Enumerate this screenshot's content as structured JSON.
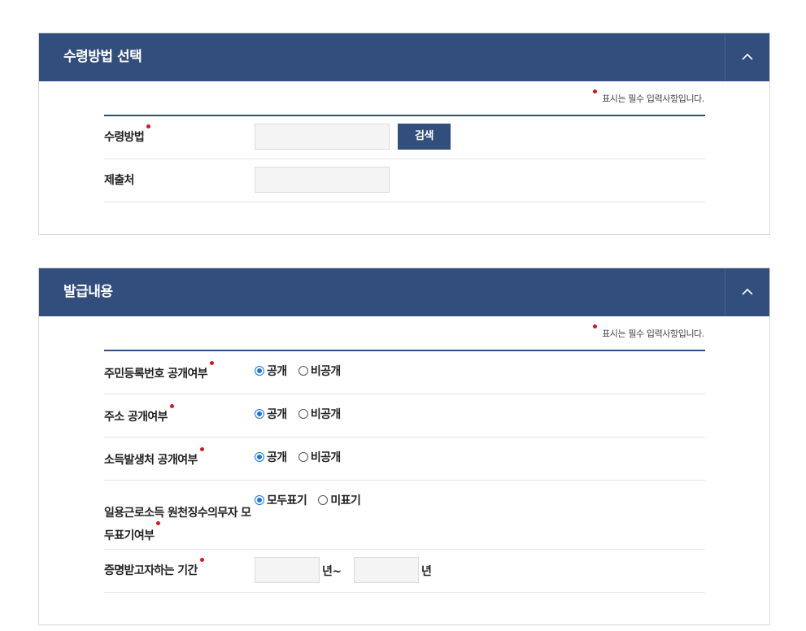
{
  "section1": {
    "title": "수령방법 선택",
    "required_note": "표시는 필수 입력사항입니다.",
    "rows": {
      "receive_method": {
        "label": "수령방법",
        "value": "",
        "search_label": "검색"
      },
      "submit_to": {
        "label": "제출처",
        "value": ""
      }
    }
  },
  "section2": {
    "title": "발급내용",
    "required_note": "표시는 필수 입력사항입니다.",
    "rows": {
      "rrn_disclosure": {
        "label": "주민등록번호 공개여부",
        "opt1": "공개",
        "opt2": "비공개",
        "selected": "공개"
      },
      "address_disclosure": {
        "label": "주소 공개여부",
        "opt1": "공개",
        "opt2": "비공개",
        "selected": "공개"
      },
      "income_source_disclosure": {
        "label": "소득발생처 공개여부",
        "opt1": "공개",
        "opt2": "비공개",
        "selected": "공개"
      },
      "daily_income_withholder": {
        "label_line1": "일용근로소득 원천징수의무자 모",
        "label_line2": "두표기여부",
        "opt1": "모두표기",
        "opt2": "미표기",
        "selected": "모두표기"
      },
      "period": {
        "label": "증명받고자하는 기간",
        "from_value": "",
        "from_unit": "년~",
        "to_value": "",
        "to_unit": "년"
      }
    }
  },
  "colors": {
    "header_bg": "#324e7d",
    "required_dot": "#d4181f",
    "radio_selected": "#1a73e8"
  }
}
